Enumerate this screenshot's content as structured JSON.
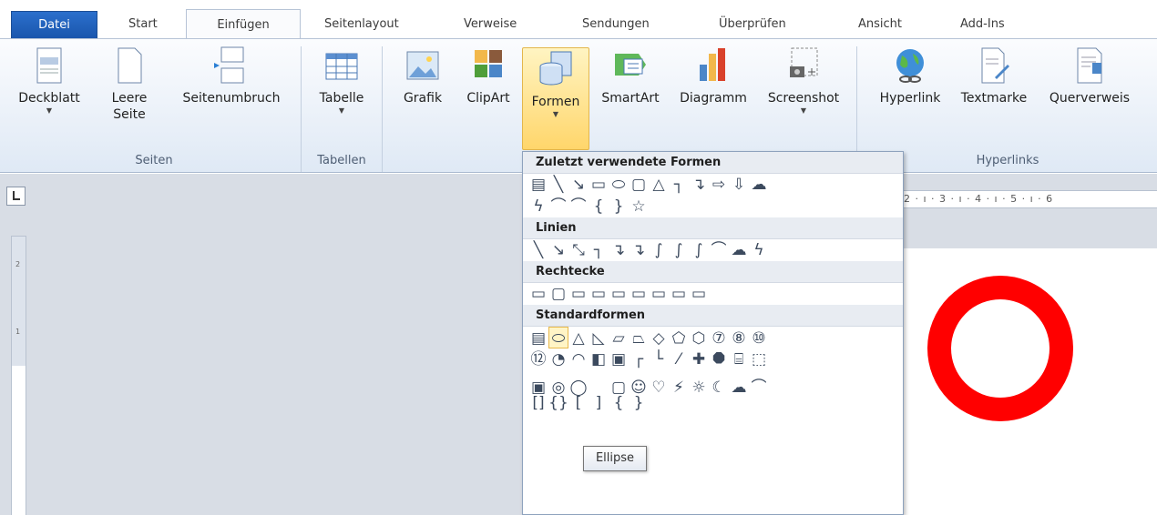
{
  "tabs": [
    {
      "label": "Datei"
    },
    {
      "label": "Start"
    },
    {
      "label": "Einfügen"
    },
    {
      "label": "Seitenlayout"
    },
    {
      "label": "Verweise"
    },
    {
      "label": "Sendungen"
    },
    {
      "label": "Überprüfen"
    },
    {
      "label": "Ansicht"
    },
    {
      "label": "Add-Ins"
    }
  ],
  "ribbon": {
    "groups": {
      "seiten": "Seiten",
      "tabellen": "Tabellen",
      "hyperlinks": "Hyperlinks"
    },
    "buttons": {
      "deckblatt": "Deckblatt",
      "leere_seite_1": "Leere",
      "leere_seite_2": "Seite",
      "seitenumbruch": "Seitenumbruch",
      "tabelle": "Tabelle",
      "grafik": "Grafik",
      "clipart": "ClipArt",
      "formen": "Formen",
      "smartart": "SmartArt",
      "diagramm": "Diagramm",
      "screenshot": "Screenshot",
      "hyperlink": "Hyperlink",
      "textmarke": "Textmarke",
      "querverweis": "Querverweis"
    },
    "dropdown_arrow": "▼"
  },
  "gallery": {
    "sections": [
      {
        "title": "Zuletzt verwendete Formen",
        "rows": [
          [
            "▤",
            "╲",
            "↘",
            "▭",
            "⬭",
            "▢",
            "△",
            "┐",
            "↴",
            "⇨",
            "⇩",
            "☁"
          ],
          [
            "ϟ",
            "⌒",
            "⌒",
            "{",
            "}",
            "☆"
          ]
        ]
      },
      {
        "title": "Linien",
        "rows": [
          [
            "╲",
            "↘",
            "⤡",
            "┐",
            "↴",
            "↴",
            "∫",
            "∫",
            "∫",
            "⌒",
            "☁",
            "ϟ"
          ]
        ]
      },
      {
        "title": "Rechtecke",
        "rows": [
          [
            "▭",
            "▢",
            "▭",
            "▭",
            "▭",
            "▭",
            "▭",
            "▭",
            "▭"
          ]
        ]
      },
      {
        "title": "Standardformen",
        "rows": [
          [
            "▤",
            "⬭",
            "△",
            "◺",
            "▱",
            "⏢",
            "◇",
            "⬠",
            "⬡",
            "⑦",
            "⑧",
            "⑩"
          ],
          [
            "⑫",
            "◔",
            "◠",
            "◧",
            "▣",
            "┌",
            "└",
            "⁄",
            "✚",
            "⯃",
            "⌸",
            "⬚"
          ],
          [
            "▣",
            "◎",
            "◯",
            "",
            "▢",
            "☺",
            "♡",
            "⚡",
            "☼",
            "☾",
            "☁",
            "⌒"
          ],
          [
            "[]",
            "{}",
            "[",
            "]",
            "{",
            "}"
          ]
        ]
      }
    ],
    "tooltip": "Ellipse"
  },
  "ruler": {
    "horizontal": "2 · ı · 3 · ı · 4 · ı · 5 · ı · 6",
    "v_marks": [
      "2",
      "1"
    ]
  },
  "colors": {
    "ring": "#ff0000",
    "file_tab": "#2b6fcc",
    "hover": "#ffd66b"
  }
}
